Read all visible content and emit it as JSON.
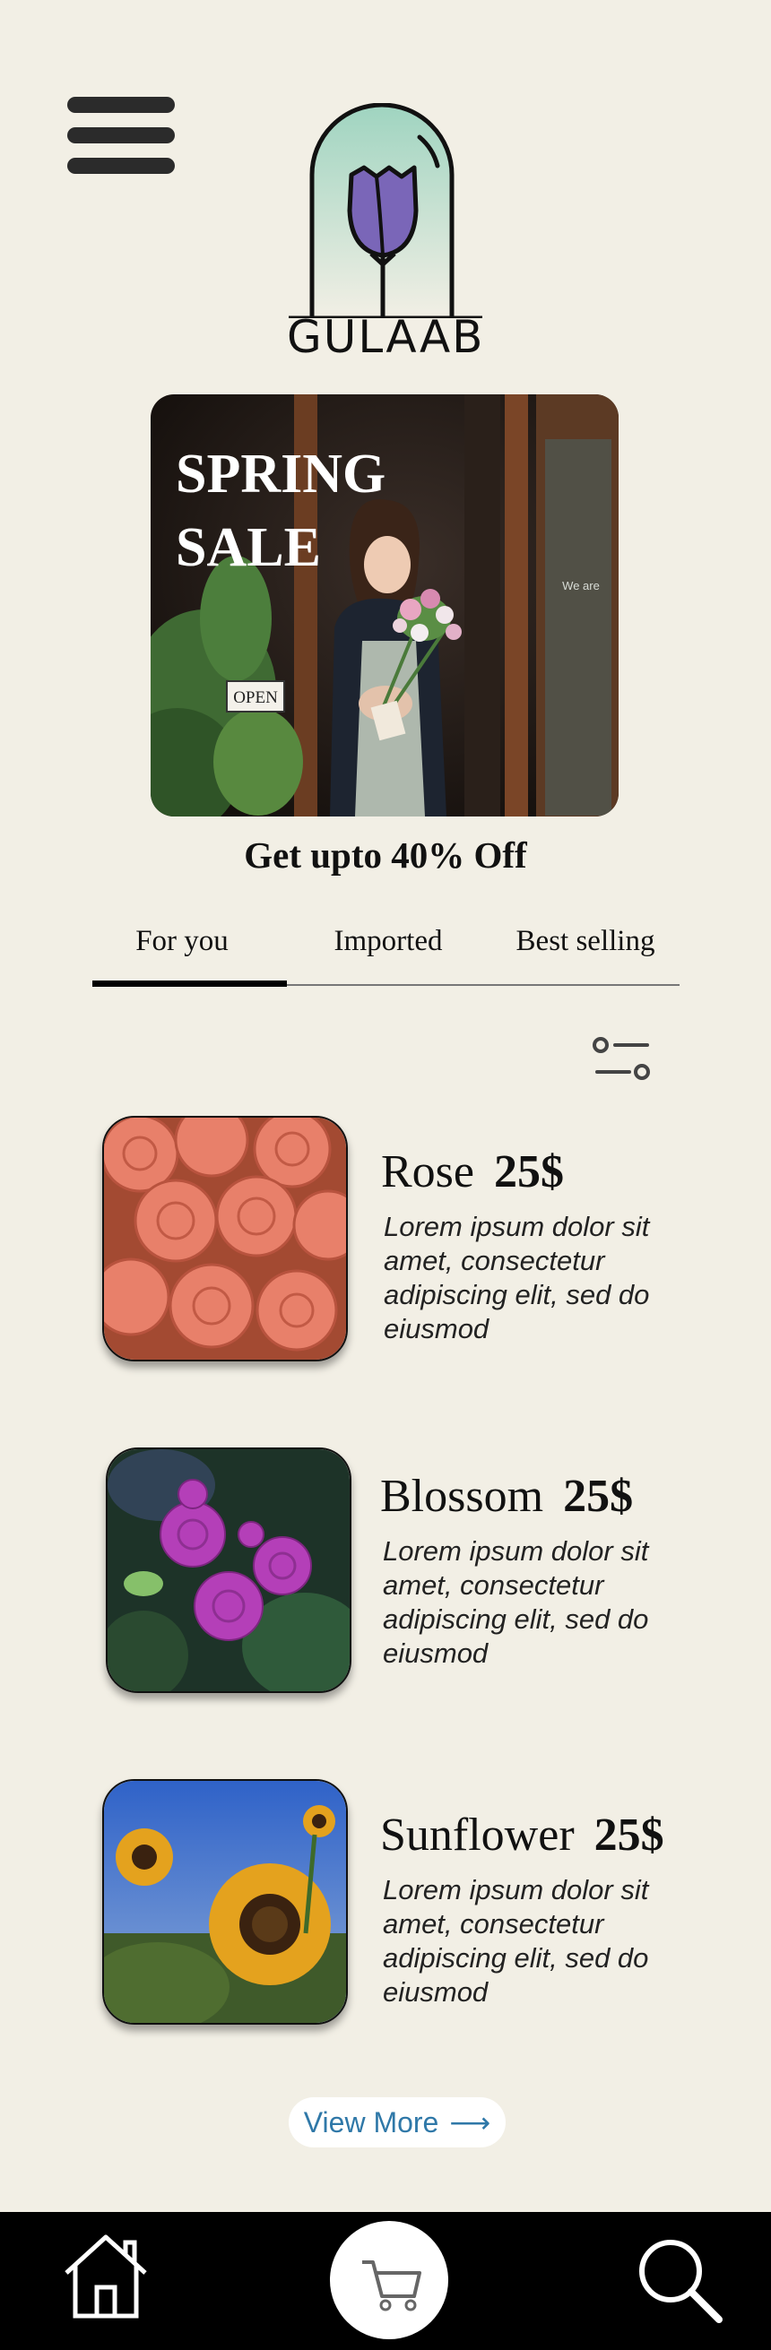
{
  "header": {
    "brand": "GULAAB"
  },
  "hero": {
    "title_line1": "SPRING",
    "title_line2": "SALE",
    "open_sign": "OPEN",
    "offer": "Get upto 40% Off"
  },
  "tabs": [
    {
      "label": "For you",
      "active": true
    },
    {
      "label": "Imported",
      "active": false
    },
    {
      "label": "Best selling",
      "active": false
    }
  ],
  "products": [
    {
      "name": "Rose",
      "price": "25$",
      "description": "Lorem ipsum dolor sit amet, consectetur adipiscing elit, sed do eiusmod"
    },
    {
      "name": "Blossom",
      "price": "25$",
      "description": "Lorem ipsum dolor sit amet, consectetur adipiscing elit, sed do eiusmod"
    },
    {
      "name": "Sunflower",
      "price": "25$",
      "description": "Lorem ipsum dolor sit amet, consectetur adipiscing elit, sed do eiusmod"
    }
  ],
  "view_more": {
    "label": "View More",
    "arrow": "⟶"
  },
  "nav": {
    "icons": [
      "home-icon",
      "cart-icon",
      "search-icon"
    ]
  },
  "colors": {
    "background": "#f2efe5",
    "accent_link": "#2f78a8",
    "nav_bar": "#000000",
    "logo_rose": "#7a66b8",
    "logo_glow": "#9fd4c0"
  }
}
